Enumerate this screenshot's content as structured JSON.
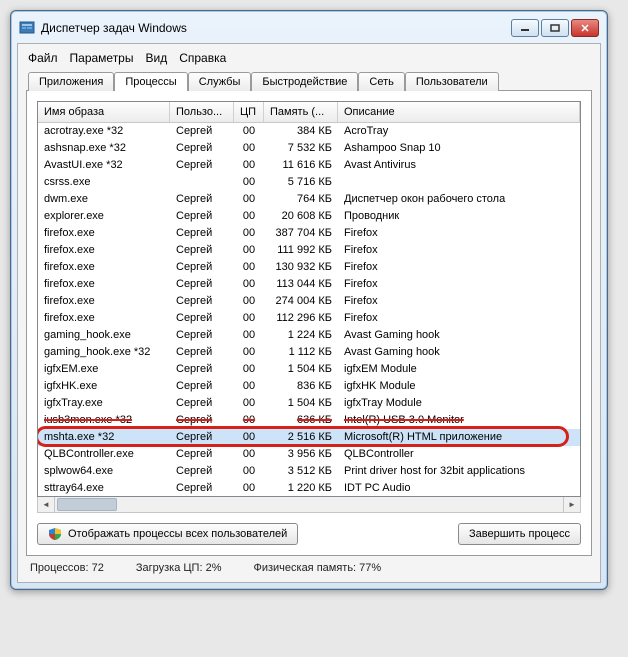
{
  "window": {
    "title": "Диспетчер задач Windows"
  },
  "menu": {
    "file": "Файл",
    "options": "Параметры",
    "view": "Вид",
    "help": "Справка"
  },
  "tabs": {
    "apps": "Приложения",
    "processes": "Процессы",
    "services": "Службы",
    "performance": "Быстродействие",
    "network": "Сеть",
    "users": "Пользователи"
  },
  "columns": {
    "image": "Имя образа",
    "user": "Пользо...",
    "cpu": "ЦП",
    "memory": "Память (...",
    "description": "Описание"
  },
  "processes": [
    {
      "image": "acrotray.exe *32",
      "user": "Сергей",
      "cpu": "00",
      "mem": "384 КБ",
      "desc": "AcroTray"
    },
    {
      "image": "ashsnap.exe *32",
      "user": "Сергей",
      "cpu": "00",
      "mem": "7 532 КБ",
      "desc": "Ashampoo Snap 10"
    },
    {
      "image": "AvastUI.exe *32",
      "user": "Сергей",
      "cpu": "00",
      "mem": "11 616 КБ",
      "desc": "Avast Antivirus"
    },
    {
      "image": "csrss.exe",
      "user": "",
      "cpu": "00",
      "mem": "5 716 КБ",
      "desc": ""
    },
    {
      "image": "dwm.exe",
      "user": "Сергей",
      "cpu": "00",
      "mem": "764 КБ",
      "desc": "Диспетчер окон рабочего стола"
    },
    {
      "image": "explorer.exe",
      "user": "Сергей",
      "cpu": "00",
      "mem": "20 608 КБ",
      "desc": "Проводник"
    },
    {
      "image": "firefox.exe",
      "user": "Сергей",
      "cpu": "00",
      "mem": "387 704 КБ",
      "desc": "Firefox"
    },
    {
      "image": "firefox.exe",
      "user": "Сергей",
      "cpu": "00",
      "mem": "111 992 КБ",
      "desc": "Firefox"
    },
    {
      "image": "firefox.exe",
      "user": "Сергей",
      "cpu": "00",
      "mem": "130 932 КБ",
      "desc": "Firefox"
    },
    {
      "image": "firefox.exe",
      "user": "Сергей",
      "cpu": "00",
      "mem": "113 044 КБ",
      "desc": "Firefox"
    },
    {
      "image": "firefox.exe",
      "user": "Сергей",
      "cpu": "00",
      "mem": "274 004 КБ",
      "desc": "Firefox"
    },
    {
      "image": "firefox.exe",
      "user": "Сергей",
      "cpu": "00",
      "mem": "112 296 КБ",
      "desc": "Firefox"
    },
    {
      "image": "gaming_hook.exe",
      "user": "Сергей",
      "cpu": "00",
      "mem": "1 224 КБ",
      "desc": "Avast Gaming hook"
    },
    {
      "image": "gaming_hook.exe *32",
      "user": "Сергей",
      "cpu": "00",
      "mem": "1 112 КБ",
      "desc": "Avast Gaming hook"
    },
    {
      "image": "igfxEM.exe",
      "user": "Сергей",
      "cpu": "00",
      "mem": "1 504 КБ",
      "desc": "igfxEM Module"
    },
    {
      "image": "igfxHK.exe",
      "user": "Сергей",
      "cpu": "00",
      "mem": "836 КБ",
      "desc": "igfxHK Module"
    },
    {
      "image": "igfxTray.exe",
      "user": "Сергей",
      "cpu": "00",
      "mem": "1 504 КБ",
      "desc": "igfxTray Module"
    },
    {
      "image": "iusb3mon.exe *32",
      "user": "Сергей",
      "cpu": "00",
      "mem": "636 КБ",
      "desc": "Intel(R) USB 3.0 Monitor",
      "strike": true
    },
    {
      "image": "mshta.exe *32",
      "user": "Сергей",
      "cpu": "00",
      "mem": "2 516 КБ",
      "desc": "Microsoft(R) HTML приложение",
      "selected": true,
      "highlighted": true
    },
    {
      "image": "QLBController.exe",
      "user": "Сергей",
      "cpu": "00",
      "mem": "3 956 КБ",
      "desc": "QLBController"
    },
    {
      "image": "splwow64.exe",
      "user": "Сергей",
      "cpu": "00",
      "mem": "3 512 КБ",
      "desc": "Print driver host for 32bit applications"
    },
    {
      "image": "sttray64.exe",
      "user": "Сергей",
      "cpu": "00",
      "mem": "1 220 КБ",
      "desc": "IDT PC Audio"
    }
  ],
  "buttons": {
    "show_all_users": "Отображать процессы всех пользователей",
    "end_process": "Завершить процесс"
  },
  "status": {
    "processes_label": "Процессов: 72",
    "cpu_label": "Загрузка ЦП: 2%",
    "memory_label": "Физическая память: 77%"
  }
}
